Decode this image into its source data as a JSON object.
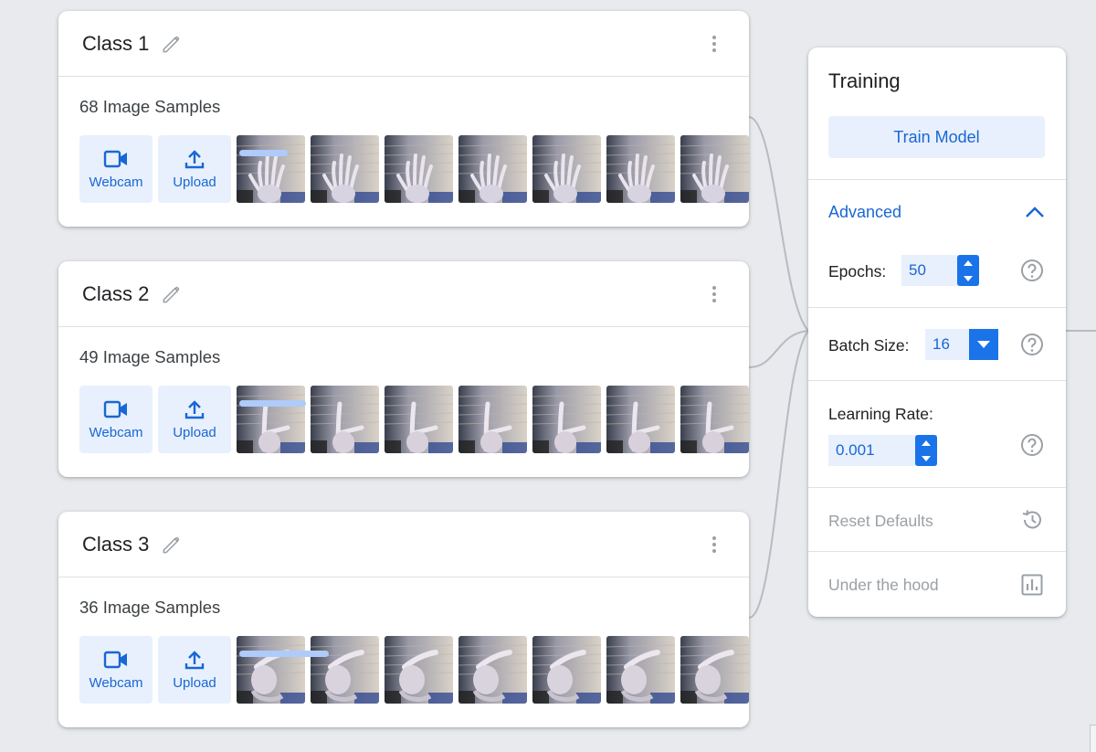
{
  "classes": [
    {
      "title": "Class 1",
      "samples_label": "68 Image Samples",
      "webcam_label": "Webcam",
      "upload_label": "Upload",
      "gesture": "open-hand",
      "scroll_fraction": 0.09
    },
    {
      "title": "Class 2",
      "samples_label": "49 Image Samples",
      "webcam_label": "Webcam",
      "upload_label": "Upload",
      "gesture": "l-shape",
      "scroll_fraction": 0.14
    },
    {
      "title": "Class 3",
      "samples_label": "36 Image Samples",
      "webcam_label": "Webcam",
      "upload_label": "Upload",
      "gesture": "pointing",
      "scroll_fraction": 0.19
    }
  ],
  "training": {
    "title": "Training",
    "train_button": "Train Model",
    "advanced_label": "Advanced",
    "epochs_label": "Epochs:",
    "epochs_value": "50",
    "batch_label": "Batch Size:",
    "batch_value": "16",
    "lr_label": "Learning Rate:",
    "lr_value": "0.001",
    "reset_label": "Reset Defaults",
    "hood_label": "Under the hood"
  },
  "colors": {
    "accent": "#1a73e8",
    "accent_text": "#1967d2",
    "accent_light": "#e8f0fe",
    "muted": "#9aa0a6",
    "scroll_thumb": "#aecbfa"
  },
  "icons": [
    "pencil-icon",
    "more-vert-icon",
    "webcam-icon",
    "upload-icon",
    "chevron-up-icon",
    "help-icon",
    "history-icon",
    "bar-chart-icon"
  ]
}
